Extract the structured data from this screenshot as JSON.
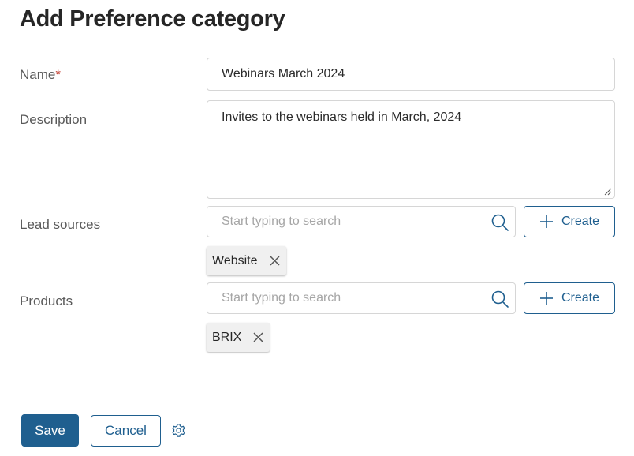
{
  "header": {
    "title": "Add Preference category"
  },
  "form": {
    "name": {
      "label": "Name",
      "required_mark": "*",
      "value": "Webinars March 2024"
    },
    "description": {
      "label": "Description",
      "value": "Invites to the webinars held in March, 2024"
    },
    "lead_sources": {
      "label": "Lead sources",
      "placeholder": "Start typing to search",
      "create_label": "Create",
      "tags": [
        {
          "label": "Website"
        }
      ]
    },
    "products": {
      "label": "Products",
      "placeholder": "Start typing to search",
      "create_label": "Create",
      "tags": [
        {
          "label": "BRIX"
        }
      ]
    }
  },
  "footer": {
    "save_label": "Save",
    "cancel_label": "Cancel"
  },
  "icons": {
    "search": "search-icon",
    "plus": "plus-icon",
    "remove": "close-icon",
    "settings": "gear-icon",
    "resize": "resize-grip-icon"
  },
  "colors": {
    "primary": "#1f5f8f",
    "required": "#c0392b",
    "border": "#d6d6d6",
    "tag_bg": "#f0f0f0"
  }
}
